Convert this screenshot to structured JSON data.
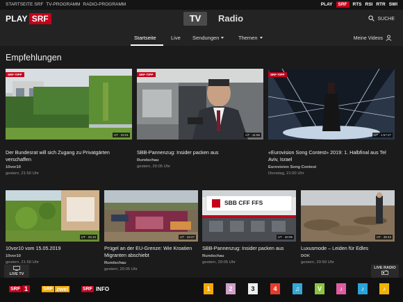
{
  "top": {
    "links": [
      "STARTSEITE SRF",
      "TV-PROGRAMM",
      "RADIO-PROGRAMM"
    ],
    "brands": [
      "PLAY",
      "SRF",
      "RTS",
      "RSI",
      "RTR",
      "SWI"
    ],
    "active_brand": "SRF"
  },
  "header": {
    "logo_play": "PLAY",
    "logo_srf": "SRF",
    "tv_label": "TV",
    "radio_label": "Radio",
    "search_label": "SUCHE",
    "nav": [
      {
        "label": "Startseite",
        "active": true
      },
      {
        "label": "Live",
        "active": false
      },
      {
        "label": "Sendungen",
        "active": false,
        "dropdown": true
      },
      {
        "label": "Themen",
        "active": false,
        "dropdown": true
      }
    ],
    "my_videos": "Meine Videos"
  },
  "section": {
    "title": "Empfehlungen"
  },
  "row1": [
    {
      "title": "Der Bundesrat will sich Zugang zu Privatgärten verschaffen",
      "show": "10vor10",
      "date": "gestern, 21:50 Uhr",
      "tip": "SRF-TIPP",
      "duration": "UT · 03:01"
    },
    {
      "title": "SBB-Pannenzug: Insider packen aus",
      "show": "Rundschau",
      "date": "gestern, 20:05 Uhr",
      "tip": "SRF-TIPP",
      "duration": "UT · 11:56"
    },
    {
      "title": "«Eurovision Song Contest» 2019: 1. Halbfinal aus Tel Aviv, Israel",
      "show": "Eurovision Song Contest",
      "date": "Dienstag, 21:00 Uhr",
      "tip": "SRF-TIPP",
      "duration": "UT · 1:57:27"
    }
  ],
  "row2": [
    {
      "title": "10vor10 vom 15.05.2019",
      "show": "10vor10",
      "date": "gestern, 21:50 Uhr",
      "duration": "UT · 25:10"
    },
    {
      "title": "Prügel an der EU-Grenze: Wie Kroatien Migranten abschiebt",
      "show": "Rundschau",
      "date": "gestern, 20:05 Uhr",
      "duration": "UT · 18:27"
    },
    {
      "title": "SBB-Pannenzug: Insider packen aus",
      "show": "Rundschau",
      "date": "gestern, 20:05 Uhr",
      "duration": "UT · 40:06",
      "sign": "SBB CFF FFS"
    },
    {
      "title": "Luxusmode – Leiden für Edles",
      "show": "DOK",
      "date": "gestern, 20:50 Uhr",
      "duration": "UT · 49:43"
    }
  ],
  "live": {
    "tv_label": "LIVE TV",
    "radio_label": "LIVE RADIO",
    "tv_channels": [
      {
        "name": "SRF 1",
        "brand": "SRF",
        "suffix": "1"
      },
      {
        "name": "SRF zwei",
        "brand": "SRF",
        "suffix": "zwei"
      },
      {
        "name": "SRF info",
        "brand": "SRF",
        "suffix": "INFO"
      }
    ],
    "radio_channels": [
      {
        "name": "Radio SRF 1",
        "mark": "1",
        "color": "#f5a800"
      },
      {
        "name": "Radio SRF 2 Kultur",
        "mark": "2",
        "color": "#cfa0c8"
      },
      {
        "name": "Radio SRF 3",
        "mark": "3",
        "color": "#eeeeee"
      },
      {
        "name": "Radio SRF 4 News",
        "mark": "4",
        "color": "#e63c2a"
      },
      {
        "name": "Radio SRF Musikwelle",
        "mark": "♫",
        "color": "#34a8d6"
      },
      {
        "name": "Radio SRF Virus",
        "mark": "V",
        "color": "#8bc53f"
      },
      {
        "name": "Radio Swiss Pop",
        "mark": "♪",
        "color": "#e05ca0"
      },
      {
        "name": "Radio Swiss Classic",
        "mark": "♪",
        "color": "#2aa5d8"
      },
      {
        "name": "Radio Swiss Jazz",
        "mark": "♪",
        "color": "#f0b400"
      }
    ]
  },
  "colors": {
    "brand_red": "#c4001a",
    "background": "#1b1b1b"
  }
}
